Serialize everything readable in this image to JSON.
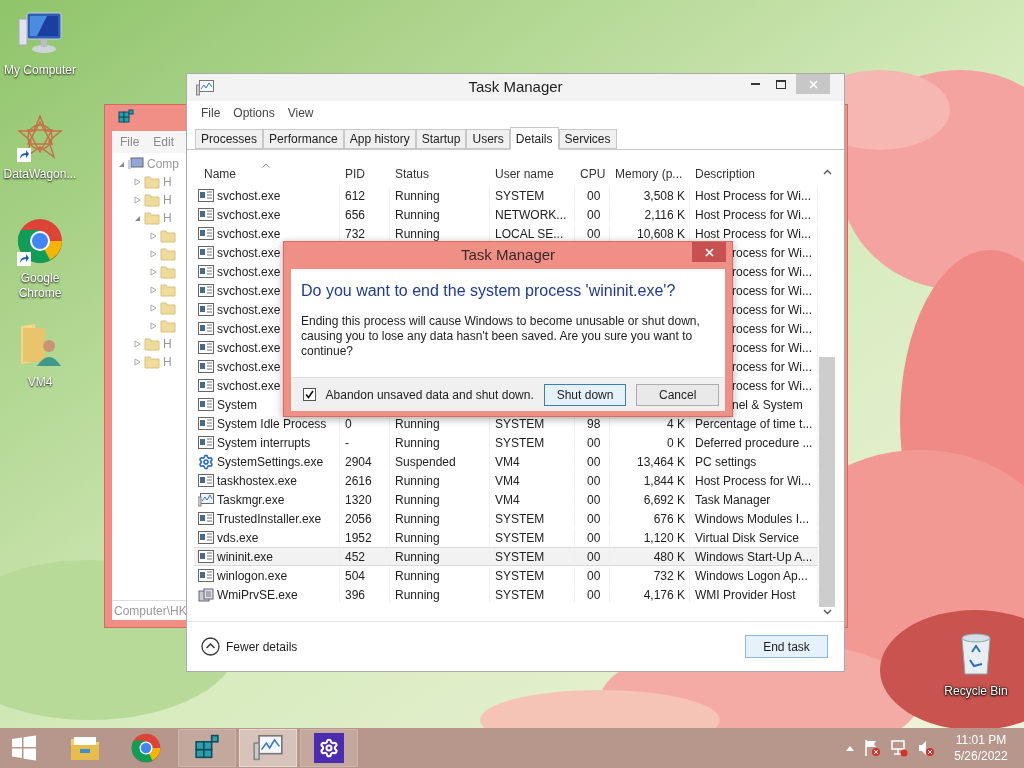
{
  "desktop_icons": [
    {
      "label": "My Computer",
      "kind": "computer",
      "shortcut": false
    },
    {
      "label": "DataWagon...",
      "kind": "star",
      "shortcut": true
    },
    {
      "label": "Google Chrome",
      "kind": "chrome",
      "shortcut": true
    },
    {
      "label": "VM4",
      "kind": "user-folder",
      "shortcut": false
    }
  ],
  "recycle_bin": {
    "label": "Recycle Bin"
  },
  "registry_window": {
    "menu": [
      "File",
      "Edit"
    ],
    "tree": [
      {
        "label": "Comp",
        "expanded": true,
        "children": [
          {
            "label": "H",
            "expanded": false
          },
          {
            "label": "H",
            "expanded": false
          },
          {
            "label": "H",
            "expanded": true,
            "children": [
              {
                "expanded": false
              },
              {
                "expanded": false
              },
              {
                "expanded": false
              },
              {
                "expanded": false
              },
              {
                "expanded": false
              },
              {
                "expanded": false
              }
            ]
          },
          {
            "label": "H",
            "expanded": false
          },
          {
            "label": "H",
            "expanded": false
          }
        ]
      }
    ],
    "status": "Computer\\HK"
  },
  "task_manager": {
    "title": "Task Manager",
    "menu": [
      "File",
      "Options",
      "View"
    ],
    "tabs": [
      {
        "label": "Processes",
        "selected": false
      },
      {
        "label": "Performance",
        "selected": false
      },
      {
        "label": "App history",
        "selected": false
      },
      {
        "label": "Startup",
        "selected": false
      },
      {
        "label": "Users",
        "selected": false
      },
      {
        "label": "Details",
        "selected": true
      },
      {
        "label": "Services",
        "selected": false
      }
    ],
    "columns": [
      {
        "label": "Name",
        "sorted": true
      },
      {
        "label": "PID",
        "sorted": false
      },
      {
        "label": "Status",
        "sorted": false
      },
      {
        "label": "User name",
        "sorted": false
      },
      {
        "label": "CPU",
        "sorted": false
      },
      {
        "label": "Memory (p...",
        "sorted": false
      },
      {
        "label": "Description",
        "sorted": false
      }
    ],
    "rows": [
      {
        "kind": "program",
        "name": "svchost.exe",
        "pid": "612",
        "status": "Running",
        "user": "SYSTEM",
        "cpu": "00",
        "memory": "3,508 K",
        "description": "Host Process for Wi...",
        "selected": false
      },
      {
        "kind": "program",
        "name": "svchost.exe",
        "pid": "656",
        "status": "Running",
        "user": "NETWORK...",
        "cpu": "00",
        "memory": "2,116 K",
        "description": "Host Process for Wi...",
        "selected": false
      },
      {
        "kind": "program",
        "name": "svchost.exe",
        "pid": "732",
        "status": "Running",
        "user": "LOCAL SE...",
        "cpu": "00",
        "memory": "10,608 K",
        "description": "Host Process for Wi...",
        "selected": false
      },
      {
        "kind": "covered",
        "name": "svchost.exe",
        "description": "rocess for Wi..."
      },
      {
        "kind": "covered",
        "name": "svchost.exe",
        "description": "rocess for Wi..."
      },
      {
        "kind": "covered",
        "name": "svchost.exe",
        "description": "rocess for Wi..."
      },
      {
        "kind": "covered",
        "name": "svchost.exe",
        "description": "rocess for Wi..."
      },
      {
        "kind": "covered",
        "name": "svchost.exe",
        "description": "rocess for Wi..."
      },
      {
        "kind": "covered",
        "name": "svchost.exe",
        "description": "rocess for Wi..."
      },
      {
        "kind": "covered",
        "name": "svchost.exe",
        "description": "rocess for Wi..."
      },
      {
        "kind": "covered",
        "name": "svchost.exe",
        "description": "rocess for Wi..."
      },
      {
        "kind": "covered",
        "name": "System",
        "description": "nel & System"
      },
      {
        "kind": "program",
        "name": "System Idle Process",
        "pid": "0",
        "status": "Running",
        "user": "SYSTEM",
        "cpu": "98",
        "memory": "4 K",
        "description": "Percentage of time t...",
        "selected": false
      },
      {
        "kind": "program",
        "name": "System interrupts",
        "pid": "-",
        "status": "Running",
        "user": "SYSTEM",
        "cpu": "00",
        "memory": "0 K",
        "description": "Deferred procedure ...",
        "selected": false
      },
      {
        "kind": "settings",
        "name": "SystemSettings.exe",
        "pid": "2904",
        "status": "Suspended",
        "user": "VM4",
        "cpu": "00",
        "memory": "13,464 K",
        "description": "PC settings",
        "selected": false
      },
      {
        "kind": "program",
        "name": "taskhostex.exe",
        "pid": "2616",
        "status": "Running",
        "user": "VM4",
        "cpu": "00",
        "memory": "1,844 K",
        "description": "Host Process for Wi...",
        "selected": false
      },
      {
        "kind": "task-manager",
        "name": "Taskmgr.exe",
        "pid": "1320",
        "status": "Running",
        "user": "VM4",
        "cpu": "00",
        "memory": "6,692 K",
        "description": "Task Manager",
        "selected": false
      },
      {
        "kind": "program",
        "name": "TrustedInstaller.exe",
        "pid": "2056",
        "status": "Running",
        "user": "SYSTEM",
        "cpu": "00",
        "memory": "676 K",
        "description": "Windows Modules I...",
        "selected": false
      },
      {
        "kind": "program",
        "name": "vds.exe",
        "pid": "1952",
        "status": "Running",
        "user": "SYSTEM",
        "cpu": "00",
        "memory": "1,120 K",
        "description": "Virtual Disk Service",
        "selected": false
      },
      {
        "kind": "program",
        "name": "wininit.exe",
        "pid": "452",
        "status": "Running",
        "user": "SYSTEM",
        "cpu": "00",
        "memory": "480 K",
        "description": "Windows Start-Up A...",
        "selected": true
      },
      {
        "kind": "program",
        "name": "winlogon.exe",
        "pid": "504",
        "status": "Running",
        "user": "SYSTEM",
        "cpu": "00",
        "memory": "732 K",
        "description": "Windows Logon Ap...",
        "selected": false
      },
      {
        "kind": "service-host",
        "name": "WmiPrvSE.exe",
        "pid": "396",
        "status": "Running",
        "user": "SYSTEM",
        "cpu": "00",
        "memory": "4,176 K",
        "description": "WMI Provider Host",
        "selected": false
      }
    ],
    "fewer_details": "Fewer details",
    "end_task": "End task"
  },
  "dialog": {
    "title": "Task Manager",
    "heading": "Do you want to end the system process 'wininit.exe'?",
    "body": "Ending this process will cause Windows to become unusable or shut down, causing you to lose any data hasn't been saved. Are you sure you want to continue?",
    "checkbox": {
      "label": "Abandon unsaved data and shut down.",
      "checked": true
    },
    "buttons": [
      {
        "label": "Shut down",
        "default": true
      },
      {
        "label": "Cancel",
        "default": false
      }
    ]
  },
  "taskbar": {
    "apps": [
      {
        "kind": "explorer",
        "open": false,
        "active": false
      },
      {
        "kind": "chrome",
        "open": false,
        "active": false
      },
      {
        "kind": "registry",
        "open": true,
        "active": false
      },
      {
        "kind": "taskmgr",
        "open": true,
        "active": true
      },
      {
        "kind": "settings",
        "open": true,
        "active": false
      }
    ],
    "time": "11:01 PM",
    "date": "5/26/2022"
  }
}
